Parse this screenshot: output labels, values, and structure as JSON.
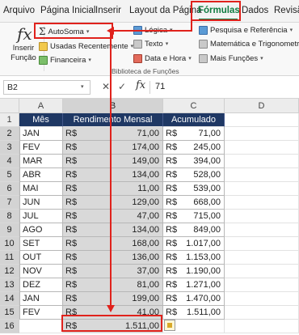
{
  "menu": {
    "tabs": [
      "Arquivo",
      "Página Inicial",
      "Inserir",
      "Layout da Página",
      "Fórmulas",
      "Dados",
      "Revisão"
    ],
    "active_tab": "Fórmulas"
  },
  "ribbon": {
    "insert_function": {
      "glyph": "fx",
      "label_line1": "Inserir",
      "label_line2": "Função"
    },
    "autosum": "AutoSoma",
    "recent": "Usadas Recentemente",
    "financial": "Financeira",
    "logical": "Lógica",
    "text": "Texto",
    "datetime": "Data e Hora",
    "lookup": "Pesquisa e Referência",
    "math": "Matemática e Trigonometria",
    "more": "Mais Funções",
    "group_label": "Biblioteca de Funções"
  },
  "formula_bar": {
    "name_box": "B2",
    "fx": "fx",
    "cancel": "✕",
    "enter": "✓",
    "value": "71"
  },
  "sheet": {
    "columns": [
      "A",
      "B",
      "C",
      "D"
    ],
    "rows": [
      "1",
      "2",
      "3",
      "4",
      "5",
      "6",
      "7",
      "8",
      "9",
      "10",
      "11",
      "12",
      "13",
      "14",
      "15",
      "16"
    ],
    "headers": {
      "month": "Mês",
      "income": "Rendimento Mensal",
      "cumulative": "Acumulado"
    },
    "currency": "R$",
    "data": [
      {
        "month": "JAN",
        "income": "71,00",
        "cumulative": "71,00"
      },
      {
        "month": "FEV",
        "income": "174,00",
        "cumulative": "245,00"
      },
      {
        "month": "MAR",
        "income": "149,00",
        "cumulative": "394,00"
      },
      {
        "month": "ABR",
        "income": "134,00",
        "cumulative": "528,00"
      },
      {
        "month": "MAI",
        "income": "11,00",
        "cumulative": "539,00"
      },
      {
        "month": "JUN",
        "income": "129,00",
        "cumulative": "668,00"
      },
      {
        "month": "JUL",
        "income": "47,00",
        "cumulative": "715,00"
      },
      {
        "month": "AGO",
        "income": "134,00",
        "cumulative": "849,00"
      },
      {
        "month": "SET",
        "income": "168,00",
        "cumulative": "1.017,00"
      },
      {
        "month": "OUT",
        "income": "136,00",
        "cumulative": "1.153,00"
      },
      {
        "month": "NOV",
        "income": "37,00",
        "cumulative": "1.190,00"
      },
      {
        "month": "DEZ",
        "income": "81,00",
        "cumulative": "1.271,00"
      },
      {
        "month": "JAN",
        "income": "199,00",
        "cumulative": "1.470,00"
      },
      {
        "month": "FEV",
        "income": "41,00",
        "cumulative": "1.511,00"
      }
    ],
    "total": "1.511,00"
  },
  "colors": {
    "header_bg": "#1f3864",
    "accent": "#107c41",
    "annotation": "#e0221c",
    "selection": "#d9d9d9"
  }
}
